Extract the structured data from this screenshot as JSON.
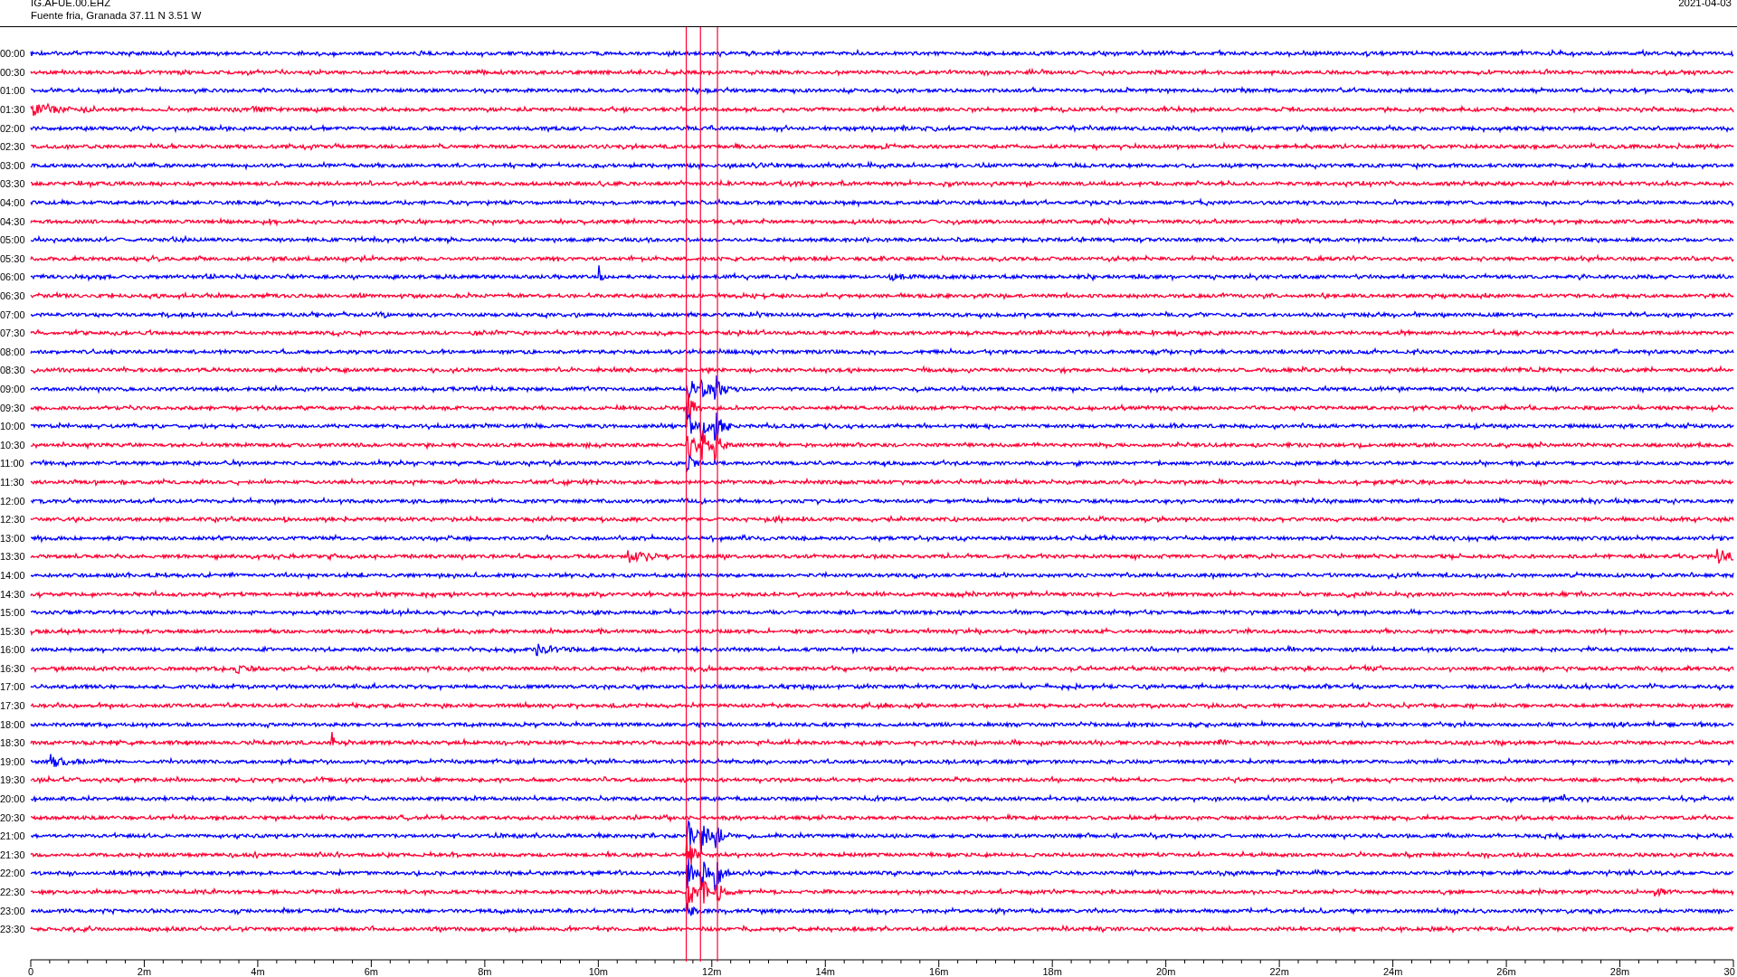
{
  "header": {
    "station": "IG.AFUE.00.EHZ",
    "location": "Fuente fria, Granada  37.11 N 3.51 W",
    "date": "2021-04-03"
  },
  "rows": [
    {
      "time": "00:00",
      "color": "#0000ff"
    },
    {
      "time": "00:30",
      "color": "#ff0033"
    },
    {
      "time": "01:00",
      "color": "#0000ff"
    },
    {
      "time": "01:30",
      "color": "#ff0033"
    },
    {
      "time": "02:00",
      "color": "#0000ff"
    },
    {
      "time": "02:30",
      "color": "#ff0033"
    },
    {
      "time": "03:00",
      "color": "#0000ff"
    },
    {
      "time": "03:30",
      "color": "#ff0033"
    },
    {
      "time": "04:00",
      "color": "#0000ff"
    },
    {
      "time": "04:30",
      "color": "#ff0033"
    },
    {
      "time": "05:00",
      "color": "#0000ff"
    },
    {
      "time": "05:30",
      "color": "#ff0033"
    },
    {
      "time": "06:00",
      "color": "#0000ff"
    },
    {
      "time": "06:30",
      "color": "#ff0033"
    },
    {
      "time": "07:00",
      "color": "#0000ff"
    },
    {
      "time": "07:30",
      "color": "#ff0033"
    },
    {
      "time": "08:00",
      "color": "#0000ff"
    },
    {
      "time": "08:30",
      "color": "#ff0033"
    },
    {
      "time": "09:00",
      "color": "#0000ff"
    },
    {
      "time": "09:30",
      "color": "#ff0033"
    },
    {
      "time": "10:00",
      "color": "#0000ff"
    },
    {
      "time": "10:30",
      "color": "#ff0033"
    },
    {
      "time": "11:00",
      "color": "#0000ff"
    },
    {
      "time": "11:30",
      "color": "#ff0033"
    },
    {
      "time": "12:00",
      "color": "#0000ff"
    },
    {
      "time": "12:30",
      "color": "#ff0033"
    },
    {
      "time": "13:00",
      "color": "#0000ff"
    },
    {
      "time": "13:30",
      "color": "#ff0033"
    },
    {
      "time": "14:00",
      "color": "#0000ff"
    },
    {
      "time": "14:30",
      "color": "#ff0033"
    },
    {
      "time": "15:00",
      "color": "#0000ff"
    },
    {
      "time": "15:30",
      "color": "#ff0033"
    },
    {
      "time": "16:00",
      "color": "#0000ff"
    },
    {
      "time": "16:30",
      "color": "#ff0033"
    },
    {
      "time": "17:00",
      "color": "#0000ff"
    },
    {
      "time": "17:30",
      "color": "#ff0033"
    },
    {
      "time": "18:00",
      "color": "#0000ff"
    },
    {
      "time": "18:30",
      "color": "#ff0033"
    },
    {
      "time": "19:00",
      "color": "#0000ff"
    },
    {
      "time": "19:30",
      "color": "#ff0033"
    },
    {
      "time": "20:00",
      "color": "#0000ff"
    },
    {
      "time": "20:30",
      "color": "#ff0033"
    },
    {
      "time": "21:00",
      "color": "#0000ff"
    },
    {
      "time": "21:30",
      "color": "#ff0033"
    },
    {
      "time": "22:00",
      "color": "#0000ff"
    },
    {
      "time": "22:30",
      "color": "#ff0033"
    },
    {
      "time": "23:00",
      "color": "#0000ff"
    },
    {
      "time": "23:30",
      "color": "#ff0033"
    }
  ],
  "axis": {
    "labels": [
      "0",
      "2m",
      "4m",
      "6m",
      "8m",
      "10m",
      "12m",
      "14m",
      "16m",
      "18m",
      "20m",
      "22m",
      "24m",
      "26m",
      "28m",
      "30"
    ]
  }
}
